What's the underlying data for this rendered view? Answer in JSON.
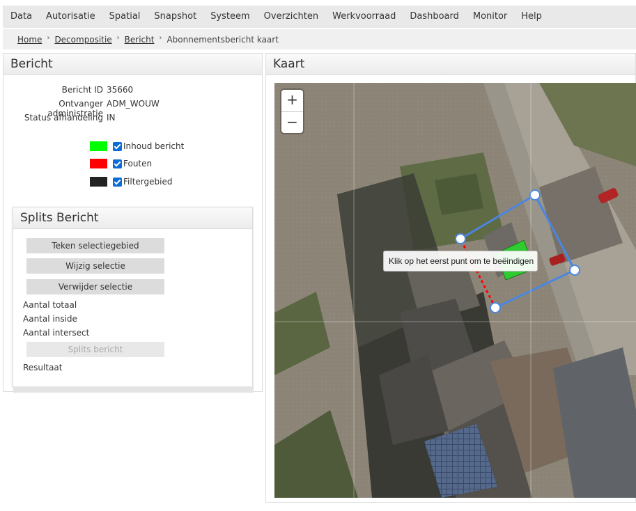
{
  "menu": {
    "items": [
      "Data",
      "Autorisatie",
      "Spatial",
      "Snapshot",
      "Systeem",
      "Overzichten",
      "Werkvoorraad",
      "Dashboard",
      "Monitor",
      "Help"
    ]
  },
  "breadcrumb": {
    "links": [
      "Home",
      "Decompositie",
      "Bericht"
    ],
    "current": "Abonnementsbericht kaart"
  },
  "bericht": {
    "title": "Bericht",
    "fields": {
      "id_label": "Bericht ID",
      "id_value": "35660",
      "ontvanger_label": "Ontvanger administratie",
      "ontvanger_value": "ADM_WOUW",
      "status_label": "Status afhandeling",
      "status_value": "IN"
    },
    "legend": [
      {
        "label": "Inhoud bericht",
        "color": "#00ff00",
        "checked": true
      },
      {
        "label": "Fouten",
        "color": "#ff0000",
        "checked": true
      },
      {
        "label": "Filtergebied",
        "color": "#222222",
        "checked": true
      }
    ]
  },
  "splits": {
    "title": "Splits Bericht",
    "buttons": {
      "teken": "Teken selectiegebied",
      "wijzig": "Wijzig selectie",
      "verwijder": "Verwijder selectie",
      "splits": "Splits bericht"
    },
    "stats": {
      "totaal": "Aantal totaal",
      "inside": "Aantal inside",
      "intersect": "Aantal intersect",
      "resultaat": "Resultaat"
    }
  },
  "kaart": {
    "title": "Kaart",
    "zoom_in": "+",
    "zoom_out": "−",
    "tooltip": "Klik op het eerst punt om te beëindigen",
    "icons": {
      "zoom_in": "plus-icon",
      "zoom_out": "minus-icon"
    },
    "colors": {
      "selection_line": "#4a86e0",
      "error_line": "#ff0000",
      "content_fill": "#2ecc2e"
    }
  }
}
